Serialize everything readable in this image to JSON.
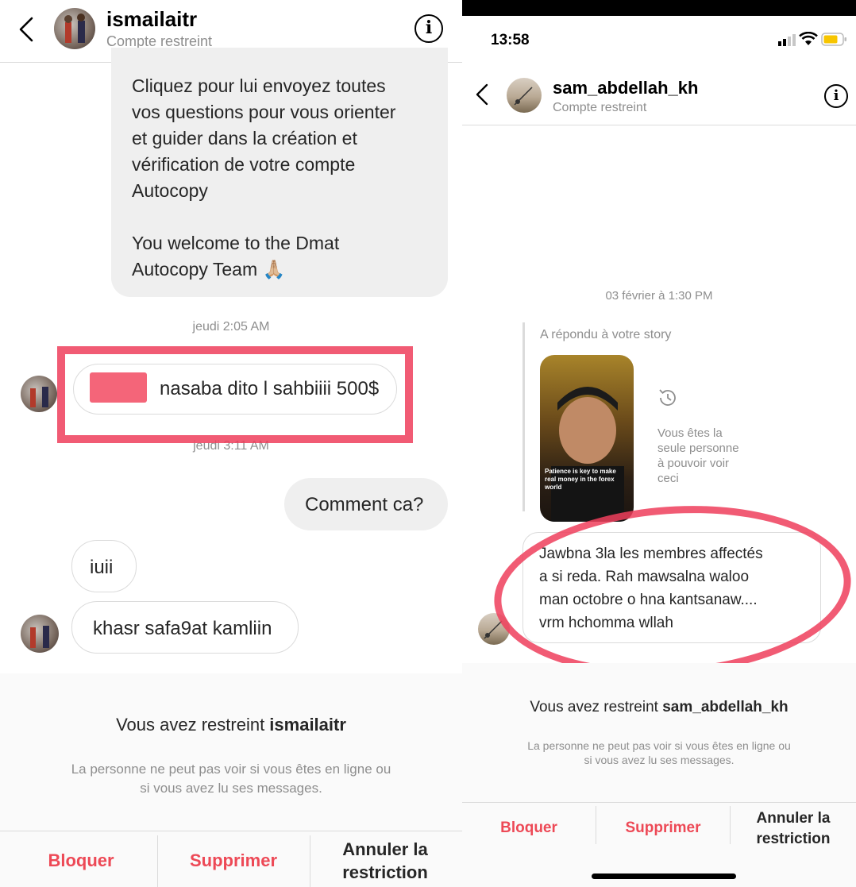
{
  "left": {
    "header": {
      "username": "ismailaitr",
      "subtitle": "Compte restreint",
      "info_glyph": "i"
    },
    "messages": {
      "incoming_long": "Cliquez pour lui envoyez toutes\nvos questions pour vous orienter\net guider dans la création et\nvérification de votre compte\nAutocopy\n\nYou welcome to the Dmat\nAutocopy Team 🙏🏼",
      "timestamp1": "jeudi 2:05 AM",
      "msg_500": "nasaba dito l sahbiiii 500$",
      "timestamp2": "jeudi 3:11 AM",
      "outgoing": "Comment ca?",
      "msg_iuii": "iuii",
      "msg_khasr": "khasr safa9at kamliin"
    },
    "restricted": {
      "prefix": "Vous avez restreint ",
      "username": "ismailaitr",
      "note": "La personne ne peut pas voir si vous êtes en ligne ou\nsi vous avez lu ses messages."
    },
    "actions": {
      "block": "Bloquer",
      "delete": "Supprimer",
      "unrestrict": "Annuler la\nrestriction"
    }
  },
  "right": {
    "status_bar": {
      "time": "13:58"
    },
    "header": {
      "username": "sam_abdellah_kh",
      "subtitle": "Compte restreint",
      "info_glyph": "i"
    },
    "timestamp": "03 février à 1:30 PM",
    "story_reply_label": "A répondu à votre story",
    "story_caption": "Patience is key to make real money in the forex world",
    "story_private_note": "Vous êtes la\nseule personne\nà pouvoir voir\nceci",
    "message": "Jawbna 3la les membres affectés\na si reda. Rah mawsalna waloo\nman octobre o hna kantsanaw....\nvrm hchomma wllah",
    "restricted": {
      "prefix": "Vous avez restreint ",
      "username": "sam_abdellah_kh",
      "note": "La personne ne peut pas voir si vous êtes en ligne ou\nsi vous avez lu ses messages."
    },
    "actions": {
      "block": "Bloquer",
      "delete": "Supprimer",
      "unrestrict": "Annuler la\nrestriction"
    }
  },
  "colors": {
    "accent_red": "#ed4956",
    "annotation_red": "#ef3e5c",
    "bubble_gray": "#efefef",
    "muted_text": "#8e8e8e",
    "divider": "#dbdbdb"
  },
  "icons": [
    "chevron-left-icon",
    "info-icon",
    "history-icon",
    "signal-icon",
    "wifi-icon",
    "battery-icon",
    "praying-hands-emoji"
  ]
}
